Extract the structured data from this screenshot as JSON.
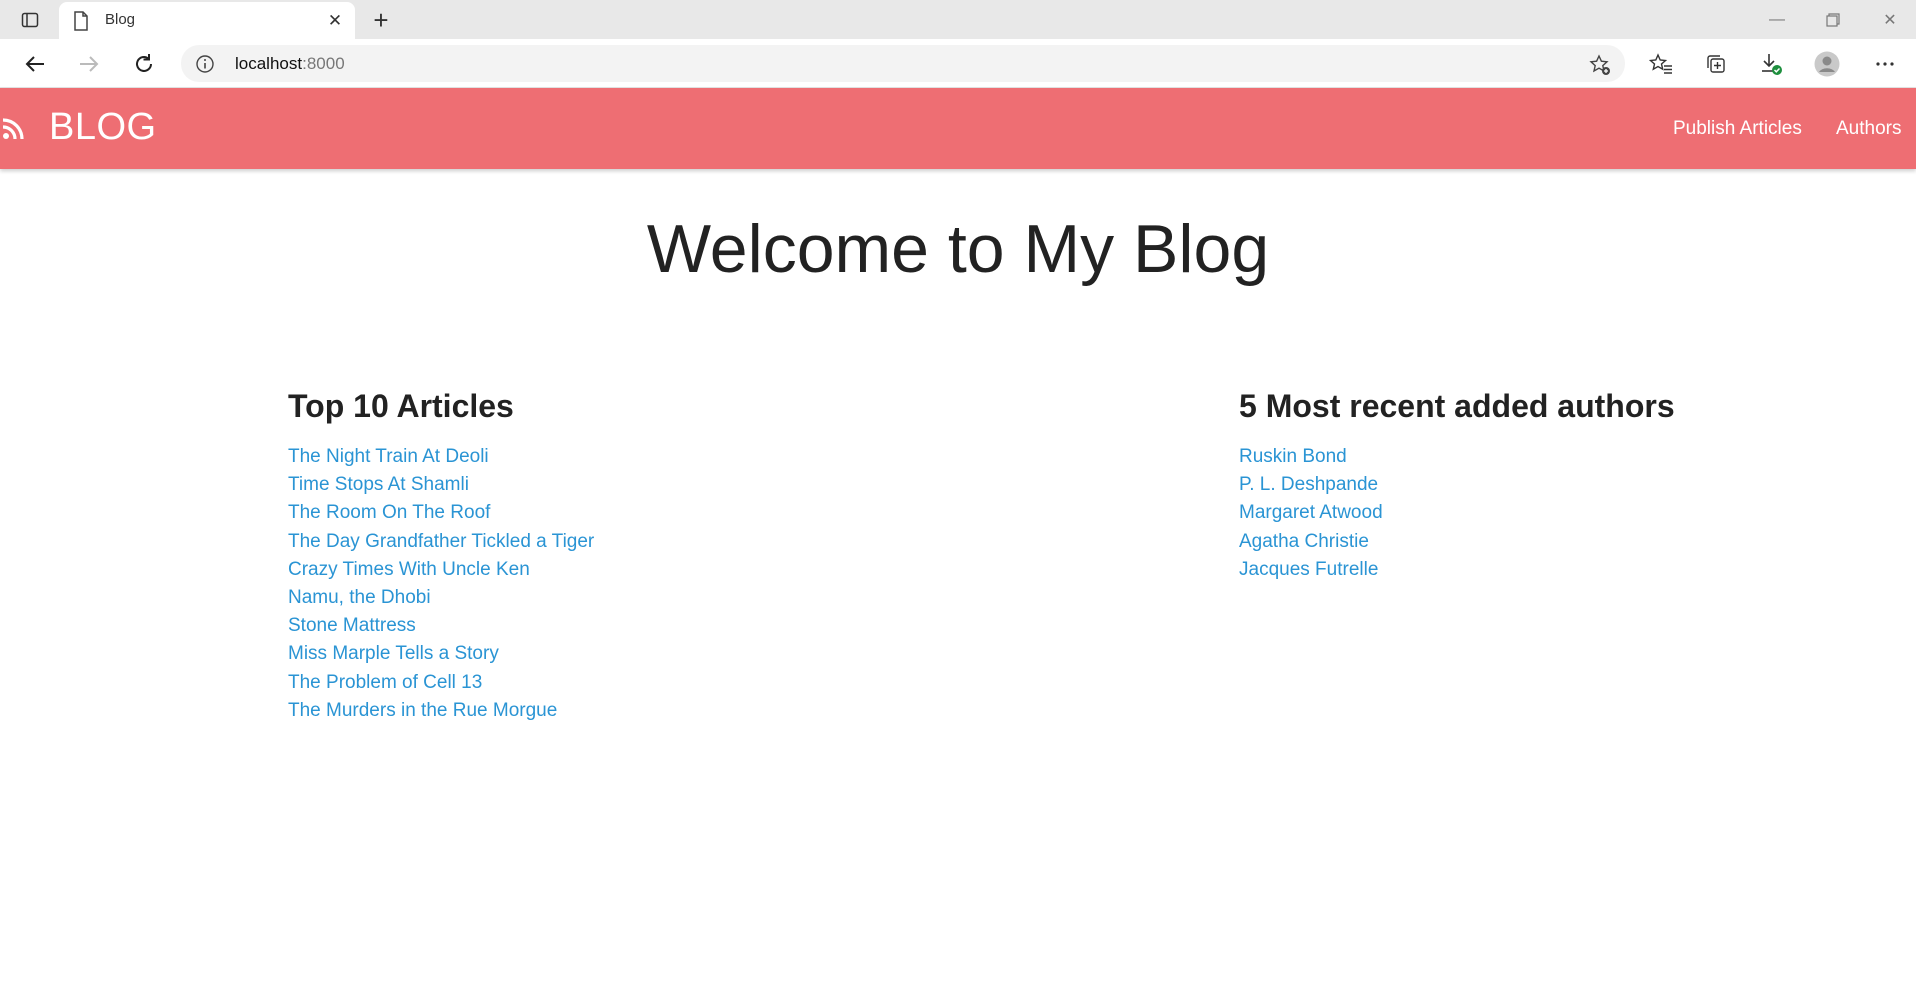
{
  "browser": {
    "tab_title": "Blog",
    "address_host": "localhost",
    "address_port": ":8000"
  },
  "navbar": {
    "brand": "BLOG",
    "links": [
      "Publish Articles",
      "Authors"
    ]
  },
  "main": {
    "title": "Welcome to My Blog",
    "articles_heading": "Top 10 Articles",
    "articles": [
      "The Night Train At Deoli",
      "Time Stops At Shamli",
      "The Room On The Roof",
      "The Day Grandfather Tickled a Tiger",
      "Crazy Times With Uncle Ken",
      "Namu, the Dhobi",
      "Stone Mattress",
      "Miss Marple Tells a Story",
      "The Problem of Cell 13",
      "The Murders in the Rue Morgue"
    ],
    "authors_heading": "5 Most recent added authors",
    "authors": [
      "Ruskin Bond",
      "P. L. Deshpande",
      "Margaret Atwood",
      "Agatha Christie",
      "Jacques Futrelle"
    ]
  },
  "colors": {
    "navbar": "#ee6e73",
    "link": "#2a94d4"
  }
}
